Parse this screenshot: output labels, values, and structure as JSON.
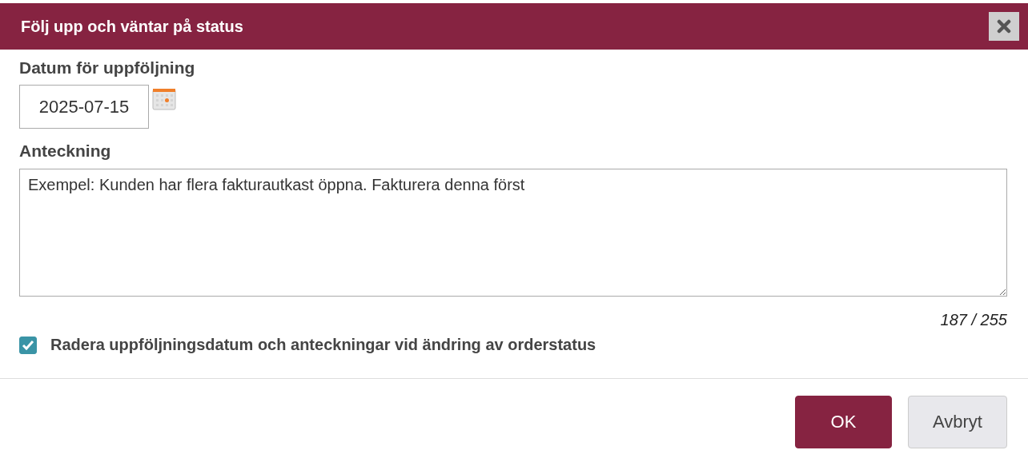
{
  "dialog": {
    "title": "Följ upp och väntar på status"
  },
  "date_field": {
    "label": "Datum för uppföljning",
    "value": "2025-07-15"
  },
  "note_field": {
    "label": "Anteckning",
    "value": "Exempel: Kunden har flera fakturautkast öppna. Fakturera denna först",
    "counter": "187 / 255"
  },
  "clear_option": {
    "label": "Radera uppföljningsdatum och anteckningar vid ändring av orderstatus",
    "checked": true
  },
  "buttons": [
    {
      "label": "OK",
      "kind": "primary"
    },
    {
      "label": "Avbryt",
      "kind": "secondary"
    }
  ]
}
